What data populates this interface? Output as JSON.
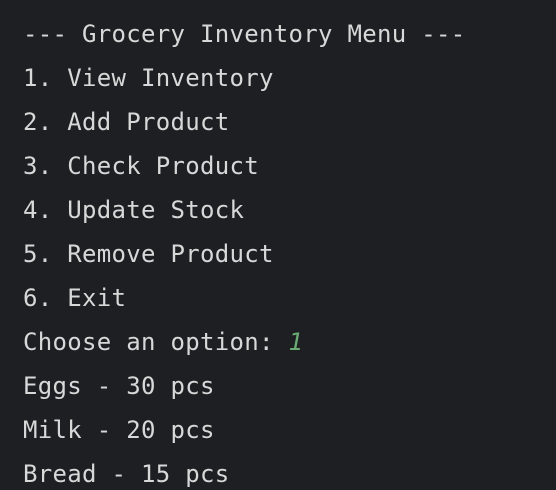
{
  "console": {
    "menu_title": "--- Grocery Inventory Menu ---",
    "menu_items": [
      "1. View Inventory",
      "2. Add Product",
      "3. Check Product",
      "4. Update Stock",
      "5. Remove Product",
      "6. Exit"
    ],
    "prompt": "Choose an option: ",
    "user_input": "1",
    "output_lines": [
      "Eggs - 30 pcs",
      "Milk - 20 pcs",
      "Bread - 15 pcs"
    ]
  },
  "colors": {
    "background": "#1e1f22",
    "text": "#d8d8d8",
    "user_input": "#6aab73"
  }
}
